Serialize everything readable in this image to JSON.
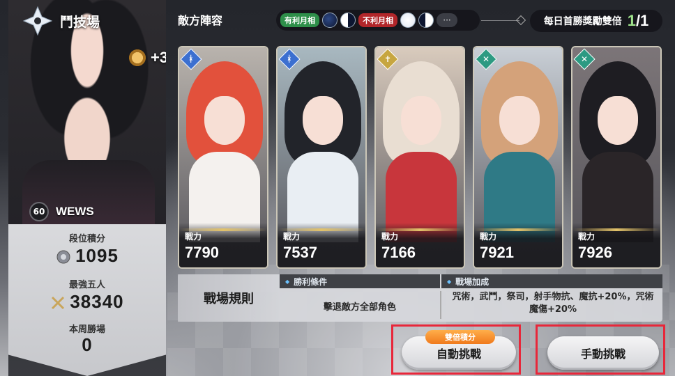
{
  "arena": {
    "title": "鬥技場",
    "rank_bonus": "+3"
  },
  "player": {
    "level": "60",
    "name": "WEWS"
  },
  "stats": [
    {
      "label": "段位積分",
      "value": "1095",
      "icon": "rank-point-icon"
    },
    {
      "label": "最強五人",
      "value": "38340",
      "icon": "sword-cross-icon"
    },
    {
      "label": "本周勝場",
      "value": "0"
    }
  ],
  "enemy": {
    "label": "敵方陣容"
  },
  "moon": {
    "good_label": "有利月相",
    "bad_label": "不利月相",
    "more": "···"
  },
  "daily": {
    "label": "每日首勝獎勵雙倍",
    "current": "1",
    "total": "/1"
  },
  "cards": [
    {
      "power_label": "戰力",
      "power": "7790",
      "class_icon": "ᚼ",
      "hair_color": "#e2513c",
      "body_color": "#f4f1ee",
      "art_bg": "#b9b3ad",
      "badge_color": "#3b6fd0"
    },
    {
      "power_label": "戰力",
      "power": "7537",
      "class_icon": "ᚼ",
      "hair_color": "#22242a",
      "body_color": "#e9eef3",
      "art_bg": "#a8b8c0",
      "badge_color": "#3b6fd0"
    },
    {
      "power_label": "戰力",
      "power": "7166",
      "class_icon": "✝",
      "hair_color": "#e9ded2",
      "body_color": "#c8363c",
      "art_bg": "#d9cbbd",
      "badge_color": "#c7a640"
    },
    {
      "power_label": "戰力",
      "power": "7921",
      "class_icon": "✕",
      "hair_color": "#d4a27a",
      "body_color": "#2f7a86",
      "art_bg": "#c9cfd6",
      "badge_color": "#2c9a82"
    },
    {
      "power_label": "戰力",
      "power": "7926",
      "class_icon": "✕",
      "hair_color": "#1e1d22",
      "body_color": "#2a2528",
      "art_bg": "#7c7578",
      "badge_color": "#2c9a82"
    }
  ],
  "rules": {
    "title": "戰場規則",
    "win_head": "勝利條件",
    "win_body": "擊退敵方全部角色",
    "bonus_head": "戰場加成",
    "bonus_body": "咒術，武鬥，祭司，射手物抗、魔抗+20%，咒術魔傷+20%"
  },
  "buttons": {
    "double_tag": "雙倍積分",
    "auto": "自動挑戰",
    "manual": "手動挑戰"
  }
}
